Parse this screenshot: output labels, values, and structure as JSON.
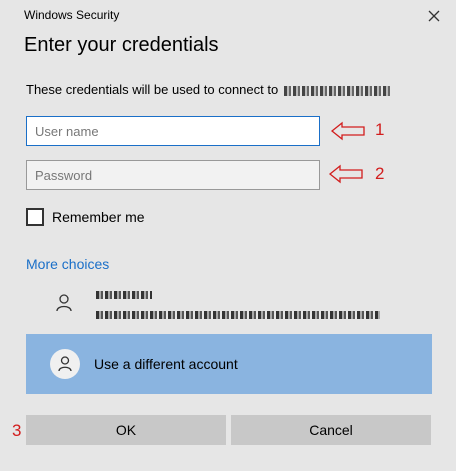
{
  "window": {
    "title": "Windows Security",
    "close_icon": "close-icon"
  },
  "dialog": {
    "heading": "Enter your credentials",
    "subtext": "These credentials will be used to connect to"
  },
  "fields": {
    "username_placeholder": "User name",
    "password_placeholder": "Password"
  },
  "remember": {
    "label": "Remember me",
    "checked": false
  },
  "more_choices": "More choices",
  "different_account": {
    "label": "Use a different account",
    "icon": "person-icon"
  },
  "buttons": {
    "ok": "OK",
    "cancel": "Cancel"
  },
  "annotations": {
    "step1": "1",
    "step2": "2",
    "step3": "3",
    "color": "#d21d1d"
  },
  "colors": {
    "accent": "#1a6fc8",
    "selected_row": "#8ab4e0",
    "background": "#e6e6e6"
  }
}
